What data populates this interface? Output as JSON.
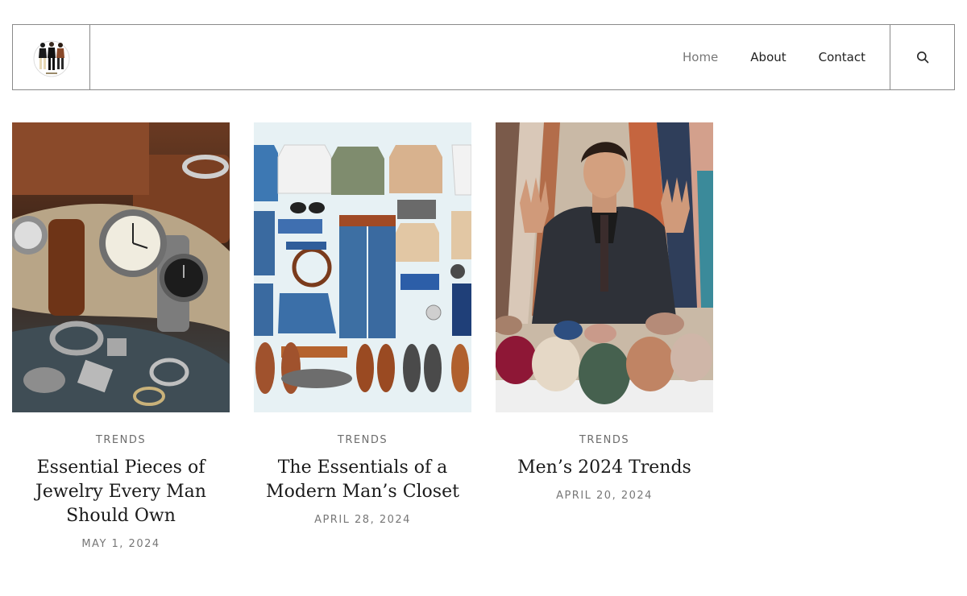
{
  "nav": {
    "items": [
      {
        "label": "Home",
        "active": true
      },
      {
        "label": "About",
        "active": false
      },
      {
        "label": "Contact",
        "active": false
      }
    ],
    "search_icon": "search-icon"
  },
  "posts": [
    {
      "category": "TRENDS",
      "title": "Essential Pieces of Jewelry Every Man Should Own",
      "date": "MAY 1, 2024",
      "image": "watches-and-rings-photo"
    },
    {
      "category": "TRENDS",
      "title": "The Essentials of a Modern Man’s Closet",
      "date": "APRIL 28, 2024",
      "image": "clothing-flat-lay-photo"
    },
    {
      "category": "TRENDS",
      "title": "Men’s 2024 Trends",
      "date": "APRIL 20, 2024",
      "image": "man-in-suit-with-fabrics-photo"
    }
  ],
  "colors": {
    "border": "#8a8a8a",
    "nav_active": "#777777",
    "meta_text": "#6d6d6d"
  }
}
